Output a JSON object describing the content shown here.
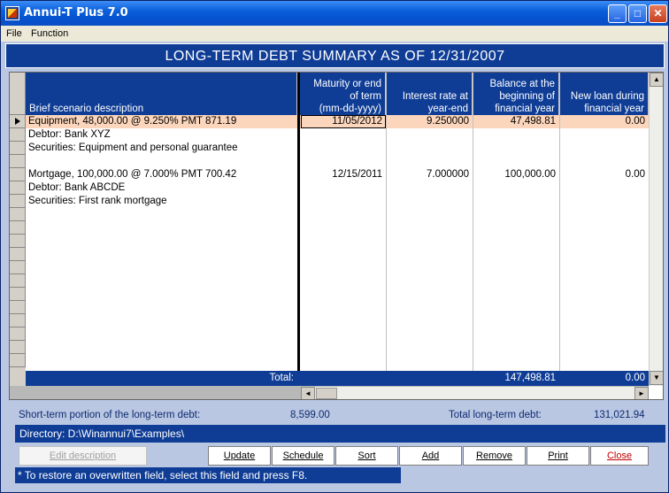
{
  "window": {
    "title": "Annui-T Plus 7.0"
  },
  "menu": {
    "file": "File",
    "function": "Function"
  },
  "banner": {
    "title": "LONG-TERM DEBT SUMMARY AS OF 12/31/2007"
  },
  "grid": {
    "columns": [
      "Brief scenario description",
      "Maturity or end\nof term\n(mm-dd-yyyy)",
      "Interest rate at\nyear-end",
      "Balance at the\nbeginning of\nfinancial year",
      "New loan during\nfinancial year"
    ],
    "rows": [
      {
        "desc": "Equipment, 48,000.00 @ 9.250% PMT 871.19",
        "maturity": "11/05/2012",
        "rate": "9.250000",
        "balance": "47,498.81",
        "newloan": "0.00"
      },
      {
        "desc": "Debtor: Bank XYZ"
      },
      {
        "desc": "Securities: Equipment and personal guarantee"
      },
      {
        "desc": ""
      },
      {
        "desc": "Mortgage, 100,000.00 @ 7.000% PMT 700.42",
        "maturity": "12/15/2011",
        "rate": "7.000000",
        "balance": "100,000.00",
        "newloan": "0.00"
      },
      {
        "desc": "Debtor: Bank ABCDE"
      },
      {
        "desc": "Securities: First rank mortgage"
      }
    ],
    "totals": {
      "label": "Total:",
      "balance": "147,498.81",
      "newloan": "0.00"
    }
  },
  "summary": {
    "short_term_label": "Short-term portion of the long-term debt:",
    "short_term_value": "8,599.00",
    "total_label": "Total long-term debt:",
    "total_value": "131,021.94"
  },
  "directory": "Directory: D:\\Winannui7\\Examples\\",
  "buttons": {
    "edit": "Edit description",
    "update": "Update",
    "schedule": "Schedule",
    "sort": "Sort",
    "add": "Add",
    "remove": "Remove",
    "print": "Print",
    "close": "Close"
  },
  "hint": "* To restore an overwritten field, select this field and press F8."
}
